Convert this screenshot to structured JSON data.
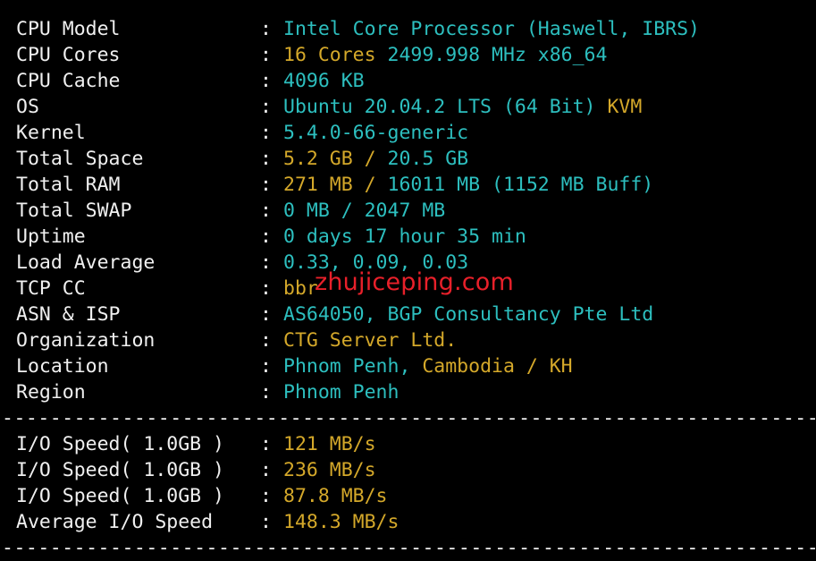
{
  "colors": {
    "background": "#000000",
    "label": "#f0f0f0",
    "cyan": "#2dbfbf",
    "yellow": "#d4a82a",
    "watermark": "#e8202a"
  },
  "separator": ":",
  "divider": "--------------------------------------------------------------------",
  "system_info": [
    {
      "label": "CPU Model",
      "value": [
        {
          "text": "Intel Core Processor (Haswell, IBRS)",
          "color": "cyan"
        }
      ]
    },
    {
      "label": "CPU Cores",
      "value": [
        {
          "text": "16 Cores ",
          "color": "yellow"
        },
        {
          "text": "2499.998 MHz x86_64",
          "color": "cyan"
        }
      ]
    },
    {
      "label": "CPU Cache",
      "value": [
        {
          "text": "4096 KB",
          "color": "cyan"
        }
      ]
    },
    {
      "label": "OS",
      "value": [
        {
          "text": "Ubuntu 20.04.2 LTS (64 Bit) ",
          "color": "cyan"
        },
        {
          "text": "KVM",
          "color": "yellow"
        }
      ]
    },
    {
      "label": "Kernel",
      "value": [
        {
          "text": "5.4.0-66-generic",
          "color": "cyan"
        }
      ]
    },
    {
      "label": "Total Space",
      "value": [
        {
          "text": "5.2 GB / ",
          "color": "yellow"
        },
        {
          "text": "20.5 GB",
          "color": "cyan"
        }
      ]
    },
    {
      "label": "Total RAM",
      "value": [
        {
          "text": "271 MB / ",
          "color": "yellow"
        },
        {
          "text": "16011 MB ",
          "color": "cyan"
        },
        {
          "text": "(1152 MB Buff)",
          "color": "cyan"
        }
      ]
    },
    {
      "label": "Total SWAP",
      "value": [
        {
          "text": "0 MB / ",
          "color": "cyan"
        },
        {
          "text": "2047 MB",
          "color": "cyan"
        }
      ]
    },
    {
      "label": "Uptime",
      "value": [
        {
          "text": "0 days 17 hour 35 min",
          "color": "cyan"
        }
      ]
    },
    {
      "label": "Load Average",
      "value": [
        {
          "text": "0.33, 0.09, 0.03",
          "color": "cyan"
        }
      ]
    },
    {
      "label": "TCP CC",
      "value": [
        {
          "text": "bbr",
          "color": "yellow"
        }
      ]
    },
    {
      "label": "ASN & ISP",
      "value": [
        {
          "text": "AS64050, BGP Consultancy Pte Ltd",
          "color": "cyan"
        }
      ]
    },
    {
      "label": "Organization",
      "value": [
        {
          "text": "CTG Server Ltd.",
          "color": "yellow"
        }
      ]
    },
    {
      "label": "Location",
      "value": [
        {
          "text": "Phnom Penh, ",
          "color": "cyan"
        },
        {
          "text": "Cambodia / KH",
          "color": "yellow"
        }
      ]
    },
    {
      "label": "Region",
      "value": [
        {
          "text": "Phnom Penh",
          "color": "cyan"
        }
      ]
    }
  ],
  "io_info": [
    {
      "label": "I/O Speed( 1.0GB )",
      "value": [
        {
          "text": "121 MB/s",
          "color": "yellow"
        }
      ]
    },
    {
      "label": "I/O Speed( 1.0GB )",
      "value": [
        {
          "text": "236 MB/s",
          "color": "yellow"
        }
      ]
    },
    {
      "label": "I/O Speed( 1.0GB )",
      "value": [
        {
          "text": "87.8 MB/s",
          "color": "yellow"
        }
      ]
    },
    {
      "label": "Average I/O Speed",
      "value": [
        {
          "text": "148.3 MB/s",
          "color": "yellow"
        }
      ]
    }
  ],
  "watermark": "zhujiceping.com"
}
